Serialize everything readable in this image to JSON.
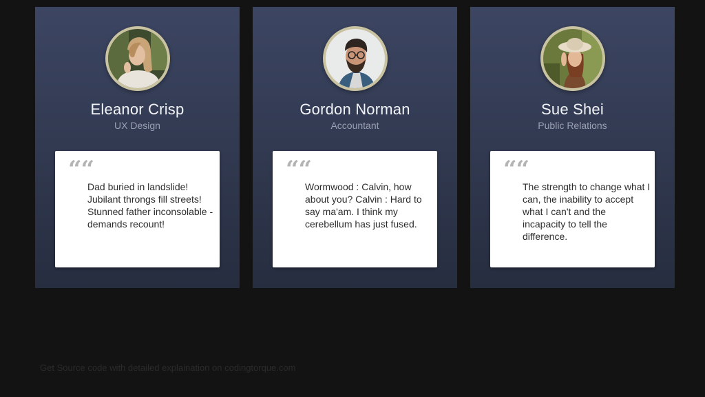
{
  "cards": [
    {
      "name": "Eleanor Crisp",
      "role": "UX Design",
      "avatar_icon": "woman-portrait",
      "quote_icon": "quote-icon",
      "quote_mark": "““",
      "quote": "Dad buried in landslide! Jubilant throngs fill streets! Stunned father inconsolable - demands recount!"
    },
    {
      "name": "Gordon Norman",
      "role": "Accountant",
      "avatar_icon": "man-portrait",
      "quote_icon": "quote-icon",
      "quote_mark": "““",
      "quote": "Wormwood : Calvin, how about you? Calvin : Hard to say ma'am. I think my cerebellum has just fused."
    },
    {
      "name": "Sue Shei",
      "role": "Public Relations",
      "avatar_icon": "woman-hat-portrait",
      "quote_icon": "quote-icon",
      "quote_mark": "““",
      "quote": "The strength to change what I can, the inability to accept what I can't and the incapacity to tell the difference."
    }
  ],
  "footer": {
    "text": "Get Source code with detailed explaination on codingtorque.com"
  },
  "colors": {
    "background": "#131313",
    "card_top": "#3c4562",
    "card_bottom": "#262d3f",
    "avatar_ring": "#c9c3a2",
    "name": "#f2f3f7",
    "role": "#9aa1b3",
    "quote_mark": "#b4b4b4",
    "quote_text": "#2c2c2c"
  }
}
